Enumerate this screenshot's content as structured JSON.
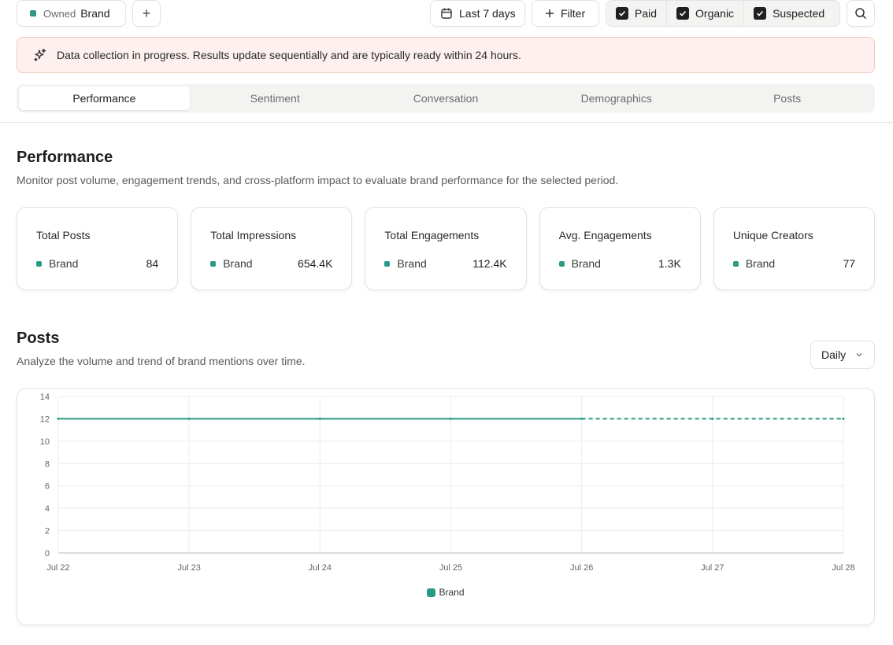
{
  "topbar": {
    "brand_chip": {
      "prefix": "Owned",
      "name": "Brand"
    },
    "add_symbol": "+",
    "date_range": "Last 7 days",
    "filter_label": "Filter",
    "toggles": [
      {
        "label": "Paid",
        "checked": true
      },
      {
        "label": "Organic",
        "checked": true
      },
      {
        "label": "Suspected",
        "checked": true
      }
    ]
  },
  "banner": {
    "text": "Data collection in progress. Results update sequentially and are typically ready within 24 hours."
  },
  "tabs": [
    {
      "label": "Performance",
      "active": true
    },
    {
      "label": "Sentiment",
      "active": false
    },
    {
      "label": "Conversation",
      "active": false
    },
    {
      "label": "Demographics",
      "active": false
    },
    {
      "label": "Posts",
      "active": false
    }
  ],
  "performance": {
    "title": "Performance",
    "subtitle": "Monitor post volume, engagement trends, and cross-platform impact to evaluate brand performance for the selected period.",
    "cards": [
      {
        "title": "Total Posts",
        "label": "Brand",
        "value": "84"
      },
      {
        "title": "Total Impressions",
        "label": "Brand",
        "value": "654.4K"
      },
      {
        "title": "Total Engagements",
        "label": "Brand",
        "value": "112.4K"
      },
      {
        "title": "Avg. Engagements",
        "label": "Brand",
        "value": "1.3K"
      },
      {
        "title": "Unique Creators",
        "label": "Brand",
        "value": "77"
      }
    ]
  },
  "posts": {
    "title": "Posts",
    "subtitle": "Analyze the volume and trend of brand mentions over time.",
    "granularity": "Daily"
  },
  "colors": {
    "brand": "#2a9a85",
    "banner_bg": "#fdf0ee",
    "banner_border": "#f1c9c2"
  },
  "chart_data": {
    "type": "line",
    "x": [
      "Jul 22",
      "Jul 23",
      "Jul 24",
      "Jul 25",
      "Jul 26",
      "Jul 27",
      "Jul 28"
    ],
    "series": [
      {
        "name": "Brand",
        "values": [
          12,
          12,
          12,
          12,
          12,
          12,
          12
        ],
        "dashed_from": "Jul 26"
      }
    ],
    "yticks": [
      0,
      2,
      4,
      6,
      8,
      10,
      12,
      14
    ],
    "ylim": [
      0,
      14
    ],
    "grid": true,
    "legend": "bottom-center"
  }
}
